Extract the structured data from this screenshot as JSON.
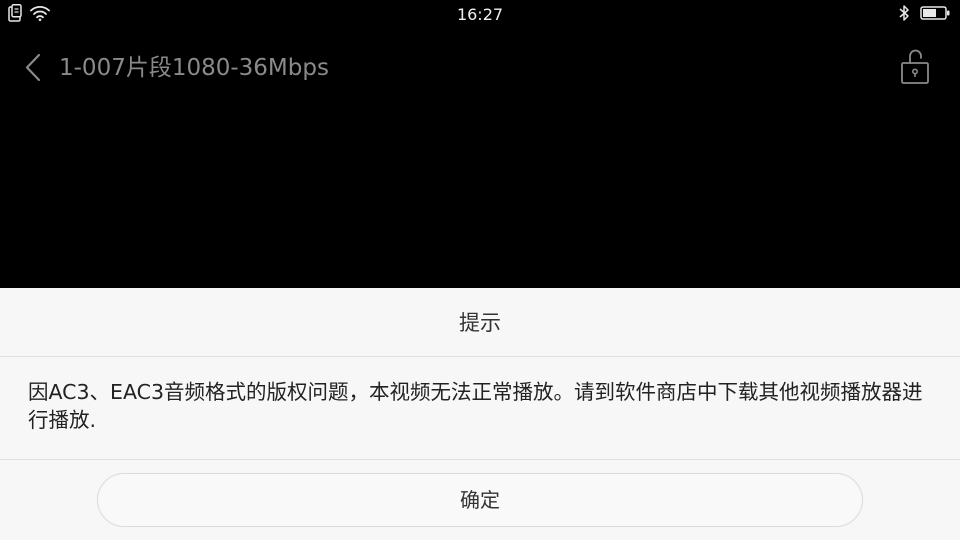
{
  "status_bar": {
    "time": "16:27",
    "icons": [
      "notification-icon",
      "wifi-icon",
      "bluetooth-icon",
      "battery-icon"
    ]
  },
  "title_bar": {
    "title": "1-007片段1080-36Mbps",
    "back_icon": "chevron-left-icon",
    "lock_icon": "unlock-icon"
  },
  "dialog": {
    "title": "提示",
    "message": "因AC3、EAC3音频格式的版权问题，本视频无法正常播放。请到软件商店中下载其他视频播放器进行播放.",
    "confirm_label": "确定"
  },
  "colors": {
    "background": "#000000",
    "dialog_bg": "#f7f7f7",
    "title_text": "#8a8a8a"
  }
}
